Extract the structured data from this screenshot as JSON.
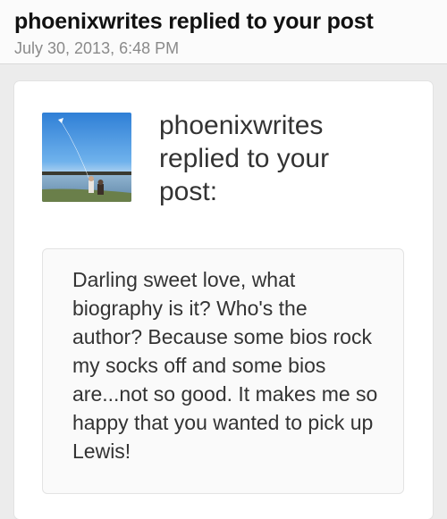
{
  "notification": {
    "title": "phoenixwrites replied to your post",
    "date": "July 30, 2013, 6:48 PM"
  },
  "card": {
    "heading": "phoenixwrites replied to your post:",
    "avatar_icon": "kite-photo-avatar",
    "reply_text": "Darling sweet love, what biography is it? Who's the author? Because some bios rock my socks off and some bios are...not so good. It makes me so happy that you wanted to pick up Lewis!"
  }
}
